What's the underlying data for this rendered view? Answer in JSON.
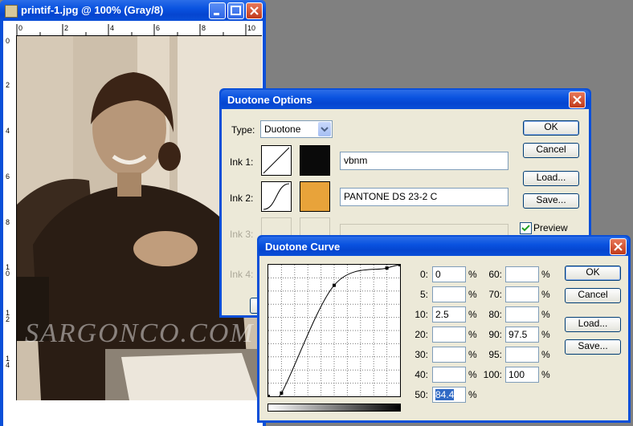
{
  "document": {
    "title": "printif-1.jpg @ 100% (Gray/8)",
    "ruler_h": [
      "0",
      "2",
      "4",
      "6",
      "8",
      "10"
    ],
    "ruler_v": [
      "0",
      "2",
      "4",
      "6",
      "8",
      "1\n0",
      "1\n2",
      "1\n4"
    ],
    "watermark": "SARGONCO.COM"
  },
  "duotone_options": {
    "title": "Duotone Options",
    "type_label": "Type:",
    "type_value": "Duotone",
    "inks": [
      {
        "label": "Ink 1:",
        "name": "vbnm",
        "color": "#0a0a0a"
      },
      {
        "label": "Ink 2:",
        "name": "PANTONE DS 23-2 C",
        "color": "#e8a33a"
      },
      {
        "label": "Ink 3:",
        "name": ""
      },
      {
        "label": "Ink 4:",
        "name": ""
      }
    ],
    "buttons": {
      "ok": "OK",
      "cancel": "Cancel",
      "load": "Load...",
      "save": "Save..."
    },
    "preview_label": "Preview",
    "preview_checked": true
  },
  "duotone_curve": {
    "title": "Duotone Curve",
    "left_labels": [
      "0:",
      "5:",
      "10:",
      "20:",
      "30:",
      "40:",
      "50:"
    ],
    "left_values": [
      "0",
      "",
      "2.5",
      "",
      "",
      "",
      "84.4"
    ],
    "right_labels": [
      "60:",
      "70:",
      "80:",
      "90:",
      "95:",
      "100:"
    ],
    "right_values": [
      "",
      "",
      "",
      "97.5",
      "",
      "100"
    ],
    "percent": "%",
    "buttons": {
      "ok": "OK",
      "cancel": "Cancel",
      "load": "Load...",
      "save": "Save..."
    },
    "curve_points": [
      [
        0,
        0
      ],
      [
        10,
        2.5
      ],
      [
        50,
        84.4
      ],
      [
        90,
        97.5
      ],
      [
        100,
        100
      ]
    ]
  }
}
